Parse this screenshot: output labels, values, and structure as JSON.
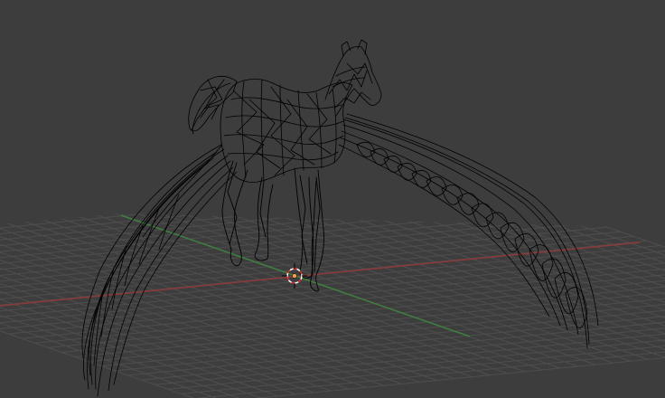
{
  "viewport": {
    "background": "#3d3d3d",
    "grid_color": "#4e4e4e",
    "x_axis_color": "#8a3a3a",
    "y_axis_color": "#3f7f3f",
    "wire_color": "#000000",
    "show_grid": true,
    "show_floor_axes": true,
    "object_shading": "wireframe",
    "object_icon": "pegasus-wireframe-icon",
    "cursor_icon": "3d-cursor-icon",
    "origin_icon": "object-origin-icon",
    "cursor_colors": [
      "#e03030",
      "#ffffff"
    ],
    "origin_color": "#f0a050"
  }
}
